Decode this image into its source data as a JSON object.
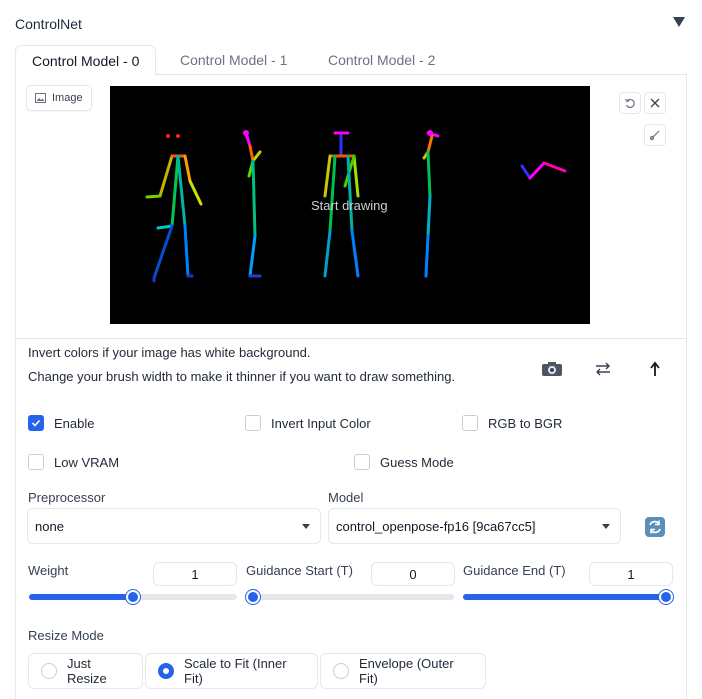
{
  "section": {
    "title": "ControlNet"
  },
  "tabs": [
    {
      "label": "Control Model - 0",
      "active": true
    },
    {
      "label": "Control Model - 1",
      "active": false
    },
    {
      "label": "Control Model - 2",
      "active": false
    }
  ],
  "image_panel": {
    "label": "Image",
    "canvas_overlay": "Start drawing",
    "icons": {
      "undo": "undo-icon",
      "clear": "close-icon",
      "brush": "brush-icon"
    }
  },
  "hints": {
    "line1": "Invert colors if your image has white background.",
    "line2": "Change your brush width to make it thinner if you want to draw something."
  },
  "action_icons": [
    "camera-icon",
    "swap-icon",
    "upload-arrow-icon"
  ],
  "checkboxes": {
    "enable": {
      "label": "Enable",
      "checked": true
    },
    "invert": {
      "label": "Invert Input Color",
      "checked": false
    },
    "rgb_bgr": {
      "label": "RGB to BGR",
      "checked": false
    },
    "low_vram": {
      "label": "Low VRAM",
      "checked": false
    },
    "guess_mode": {
      "label": "Guess Mode",
      "checked": false
    }
  },
  "preprocessor": {
    "label": "Preprocessor",
    "value": "none"
  },
  "model": {
    "label": "Model",
    "value": "control_openpose-fp16 [9ca67cc5]"
  },
  "sliders": {
    "weight": {
      "label": "Weight",
      "value": "1",
      "fraction": 0.5
    },
    "guidance_start": {
      "label": "Guidance Start (T)",
      "value": "0",
      "fraction": 0.0
    },
    "guidance_end": {
      "label": "Guidance End (T)",
      "value": "1",
      "fraction": 1.0
    }
  },
  "resize_mode": {
    "label": "Resize Mode",
    "options": [
      {
        "label": "Just Resize",
        "selected": false
      },
      {
        "label": "Scale to Fit (Inner Fit)",
        "selected": true
      },
      {
        "label": "Envelope (Outer Fit)",
        "selected": false
      }
    ]
  },
  "colors": {
    "accent": "#2563eb",
    "canvas_bg": "#000000",
    "border": "#e5e7eb"
  }
}
